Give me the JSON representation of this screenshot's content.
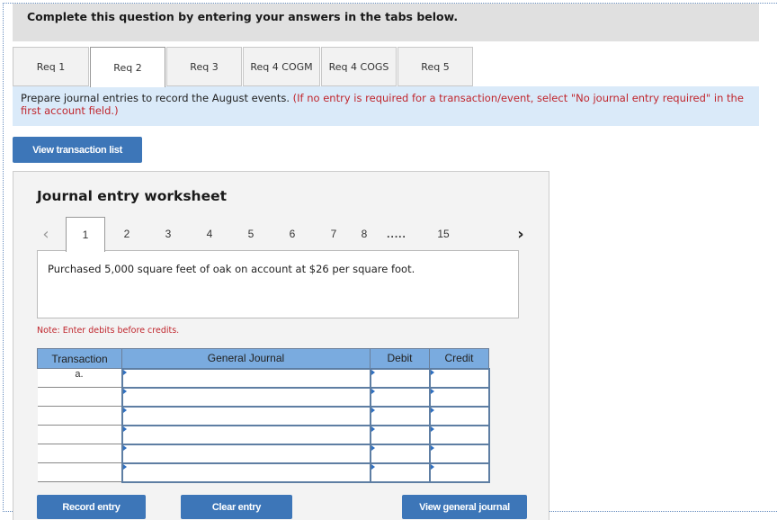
{
  "instructions": "Complete this question by entering your answers in the tabs below.",
  "tabs": [
    {
      "label": "Req 1",
      "active": false
    },
    {
      "label": "Req 2",
      "active": true
    },
    {
      "label": "Req 3",
      "active": false
    },
    {
      "label": "Req 4 COGM",
      "active": false
    },
    {
      "label": "Req 4 COGS",
      "active": false
    },
    {
      "label": "Req 5",
      "active": false
    }
  ],
  "prompt": {
    "text": "Prepare journal entries to record the August events. ",
    "hint": "(If no entry is required for a transaction/event, select \"No journal entry required\" in the first account field.)"
  },
  "view_transaction_list_label": "View transaction list",
  "worksheet": {
    "title": "Journal entry worksheet",
    "pager": {
      "prev_icon": "‹",
      "next_icon": "›",
      "pages": [
        "1",
        "2",
        "3",
        "4",
        "5",
        "6",
        "7",
        "8"
      ],
      "ellipsis": ".....",
      "last_page": "15",
      "active_page": "1"
    },
    "description": "Purchased 5,000 square feet of oak on account at $26 per square foot.",
    "note": "Note: Enter debits before credits.",
    "table": {
      "headers": [
        "Transaction",
        "General Journal",
        "Debit",
        "Credit"
      ],
      "rows": [
        {
          "transaction": "a.",
          "account": "",
          "debit": "",
          "credit": ""
        },
        {
          "transaction": "",
          "account": "",
          "debit": "",
          "credit": ""
        },
        {
          "transaction": "",
          "account": "",
          "debit": "",
          "credit": ""
        },
        {
          "transaction": "",
          "account": "",
          "debit": "",
          "credit": ""
        },
        {
          "transaction": "",
          "account": "",
          "debit": "",
          "credit": ""
        },
        {
          "transaction": "",
          "account": "",
          "debit": "",
          "credit": ""
        }
      ]
    },
    "buttons": {
      "record": "Record entry",
      "clear": "Clear entry",
      "view_journal": "View general journal"
    }
  },
  "colors": {
    "accent_button": "#3d76b8",
    "header_blue": "#7aabdf",
    "prompt_bg": "#daeaf9",
    "hint_red": "#c0262d"
  }
}
